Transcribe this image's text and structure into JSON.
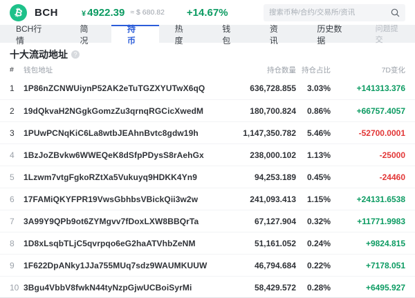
{
  "header": {
    "coin_name": "BCH",
    "price_symbol": "¥",
    "price": "4922.39",
    "price_usd": "≈ $ 680.82",
    "change": "+14.67%",
    "search_placeholder": "搜索币种/合约/交易所/资讯"
  },
  "tabs": {
    "items": [
      "BCH行情",
      "简况",
      "持币",
      "热度",
      "钱包",
      "资讯",
      "历史数据"
    ],
    "active": "持币",
    "right_link": "问题提交"
  },
  "section": {
    "title": "十大流动地址"
  },
  "table": {
    "headers": {
      "rank": "#",
      "address": "钱包地址",
      "quantity": "持仓数量",
      "ratio": "持仓占比",
      "change7d": "7D变化"
    },
    "rows": [
      {
        "rank": "1",
        "address": "1P86nZCNWUiynP52AK2eTuTGZXYUTwX6qQ",
        "quantity": "636,728.855",
        "ratio": "3.03%",
        "change7d": "+141313.376"
      },
      {
        "rank": "2",
        "address": "19dQkvaH2NGgkGomzZu3qrnqRGCicXwedM",
        "quantity": "180,700.824",
        "ratio": "0.86%",
        "change7d": "+66757.4057"
      },
      {
        "rank": "3",
        "address": "1PUwPCNqKiC6La8wtbJEAhnBvtc8gdw19h",
        "quantity": "1,147,350.782",
        "ratio": "5.46%",
        "change7d": "-52700.0001"
      },
      {
        "rank": "4",
        "address": "1BzJoZBvkw6WWEQeK8dSfpPDysS8rAehGx",
        "quantity": "238,000.102",
        "ratio": "1.13%",
        "change7d": "-25000"
      },
      {
        "rank": "5",
        "address": "1Lzwm7vtgFgkoRZtXa5Vukuyq9HDKK4Yn9",
        "quantity": "94,253.189",
        "ratio": "0.45%",
        "change7d": "-24460"
      },
      {
        "rank": "6",
        "address": "17FAMiQKYFPR19VwsGbhbsVBickQii3w2w",
        "quantity": "241,093.413",
        "ratio": "1.15%",
        "change7d": "+24131.6538"
      },
      {
        "rank": "7",
        "address": "3A99Y9QPb9ot6ZYMgvv7fDoxLXW8BBQrTa",
        "quantity": "67,127.904",
        "ratio": "0.32%",
        "change7d": "+11771.9983"
      },
      {
        "rank": "8",
        "address": "1D8xLsqbTLjC5qvrpqo6eG2haATVhbZeNM",
        "quantity": "51,161.052",
        "ratio": "0.24%",
        "change7d": "+9824.815"
      },
      {
        "rank": "9",
        "address": "1F622DpANky1JJa755MUq7sdz9WAUMKUUW",
        "quantity": "46,794.684",
        "ratio": "0.22%",
        "change7d": "+7178.051"
      },
      {
        "rank": "10",
        "address": "3Bgu4VbbV8fwkN44tyNzpGjwUCBoiSyrMi",
        "quantity": "58,429.572",
        "ratio": "0.28%",
        "change7d": "+6495.927"
      }
    ]
  },
  "colors": {
    "up": "#0c9b62",
    "down": "#e23636",
    "accent_blue": "#2b5cd9",
    "brand_green": "#1ec18a"
  }
}
